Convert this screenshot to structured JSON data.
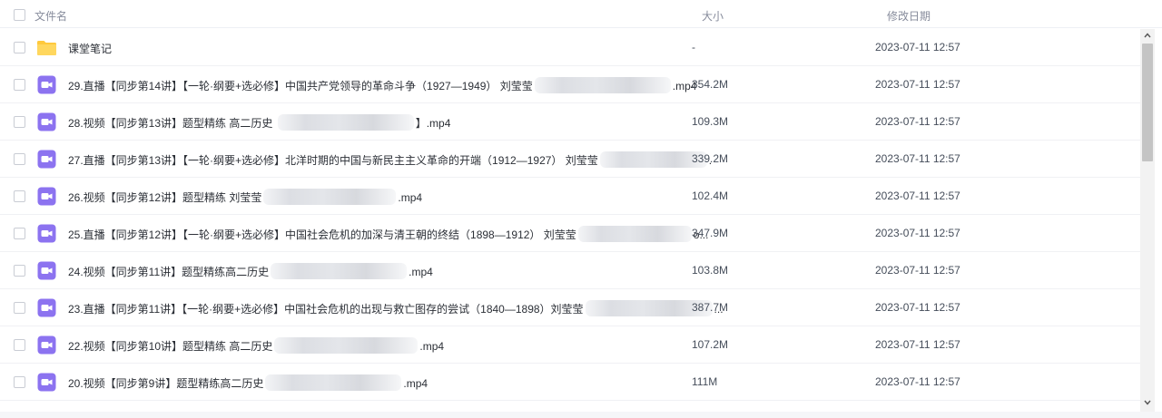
{
  "header": {
    "name_label": "文件名",
    "size_label": "大小",
    "date_label": "修改日期"
  },
  "rows": [
    {
      "icon": "folder-icon",
      "name": "课堂笔记",
      "name_suffix": "",
      "blur_w": 0,
      "size": "-",
      "date": "2023-07-11 12:57"
    },
    {
      "icon": "video-icon",
      "name": "29.直播【同步第14讲】【一轮·纲要+选必修】中国共产党领导的革命斗争（1927—1949） 刘莹莹",
      "name_suffix": ".mp4",
      "blur_w": 1,
      "size": "354.2M",
      "date": "2023-07-11 12:57"
    },
    {
      "icon": "video-icon",
      "name": "28.视频【同步第13讲】题型精练 高二历史 ",
      "name_suffix": "】.mp4",
      "blur_w": 1,
      "size": "109.3M",
      "date": "2023-07-11 12:57"
    },
    {
      "icon": "video-icon",
      "name": "27.直播【同步第13讲】【一轮·纲要+选必修】北洋时期的中国与新民主主义革命的开端（1912—1927） 刘莹莹",
      "name_suffix": ".",
      "blur_w": 1,
      "size": "339.2M",
      "date": "2023-07-11 12:57"
    },
    {
      "icon": "video-icon",
      "name": "26.视频【同步第12讲】题型精练 刘莹莹",
      "name_suffix": ".mp4",
      "blur_w": 1,
      "size": "102.4M",
      "date": "2023-07-11 12:57"
    },
    {
      "icon": "video-icon",
      "name": "25.直播【同步第12讲】【一轮·纲要+选必修】中国社会危机的加深与清王朝的终结（1898—1912） 刘莹莹",
      "name_suffix": "o...",
      "blur_w": 1,
      "size": "347.9M",
      "date": "2023-07-11 12:57"
    },
    {
      "icon": "video-icon",
      "name": "24.视频【同步第11讲】题型精练高二历史",
      "name_suffix": ".mp4",
      "blur_w": 1,
      "size": "103.8M",
      "date": "2023-07-11 12:57"
    },
    {
      "icon": "video-icon",
      "name": "23.直播【同步第11讲】【一轮·纲要+选必修】中国社会危机的出现与救亡图存的尝试（1840—1898）刘莹莹",
      "name_suffix": "...",
      "blur_w": 1,
      "size": "387.7M",
      "date": "2023-07-11 12:57"
    },
    {
      "icon": "video-icon",
      "name": "22.视频【同步第10讲】题型精练 高二历史",
      "name_suffix": ".mp4",
      "blur_w": 1,
      "size": "107.2M",
      "date": "2023-07-11 12:57"
    },
    {
      "icon": "video-icon",
      "name": "20.视频【同步第9讲】题型精练高二历史",
      "name_suffix": ".mp4",
      "blur_w": 1,
      "size": "111M",
      "date": "2023-07-11 12:57"
    }
  ]
}
